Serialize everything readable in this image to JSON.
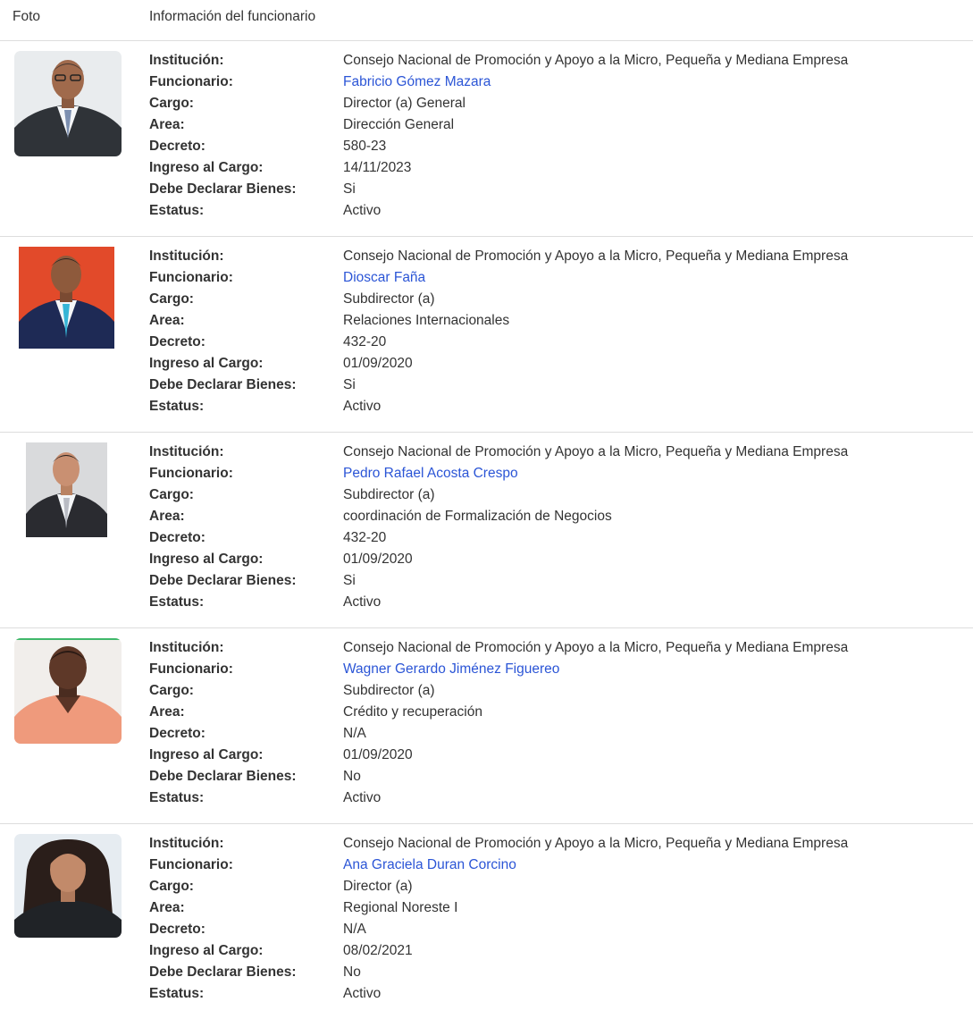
{
  "table": {
    "col_foto": "Foto",
    "col_info": "Información del funcionario"
  },
  "labels": {
    "institucion": "Institución:",
    "funcionario": "Funcionario:",
    "cargo": "Cargo:",
    "area": "Area:",
    "decreto": "Decreto:",
    "ingreso": "Ingreso al Cargo:",
    "declarar": "Debe Declarar Bienes:",
    "estatus": "Estatus:"
  },
  "officials": [
    {
      "institucion": "Consejo Nacional de Promoción y Apoyo a la Micro, Pequeña y Mediana Empresa",
      "funcionario": "Fabricio Gómez Mazara",
      "cargo": "Director (a) General",
      "area": "Dirección General",
      "decreto": "580-23",
      "ingreso": "14/11/2023",
      "declarar": "Si",
      "estatus": "Activo"
    },
    {
      "institucion": "Consejo Nacional de Promoción y Apoyo a la Micro, Pequeña y Mediana Empresa",
      "funcionario": "Dioscar Faña",
      "cargo": "Subdirector (a)",
      "area": "Relaciones Internacionales",
      "decreto": "432-20",
      "ingreso": "01/09/2020",
      "declarar": "Si",
      "estatus": "Activo"
    },
    {
      "institucion": "Consejo Nacional de Promoción y Apoyo a la Micro, Pequeña y Mediana Empresa",
      "funcionario": "Pedro Rafael Acosta Crespo",
      "cargo": "Subdirector (a)",
      "area": "coordinación de Formalización de Negocios",
      "decreto": "432-20",
      "ingreso": "01/09/2020",
      "declarar": "Si",
      "estatus": "Activo"
    },
    {
      "institucion": "Consejo Nacional de Promoción y Apoyo a la Micro, Pequeña y Mediana Empresa",
      "funcionario": "Wagner Gerardo Jiménez Figuereo",
      "cargo": "Subdirector (a)",
      "area": "Crédito y recuperación",
      "decreto": "N/A",
      "ingreso": "01/09/2020",
      "declarar": "No",
      "estatus": "Activo"
    },
    {
      "institucion": "Consejo Nacional de Promoción y Apoyo a la Micro, Pequeña y Mediana Empresa",
      "funcionario": "Ana Graciela Duran Corcino",
      "cargo": "Director (a)",
      "area": "Regional Noreste I",
      "decreto": "N/A",
      "ingreso": "08/02/2021",
      "declarar": "No",
      "estatus": "Activo"
    }
  ],
  "colors": {
    "link": "#2b55d6",
    "text": "#333333",
    "divider": "#dddddd"
  }
}
